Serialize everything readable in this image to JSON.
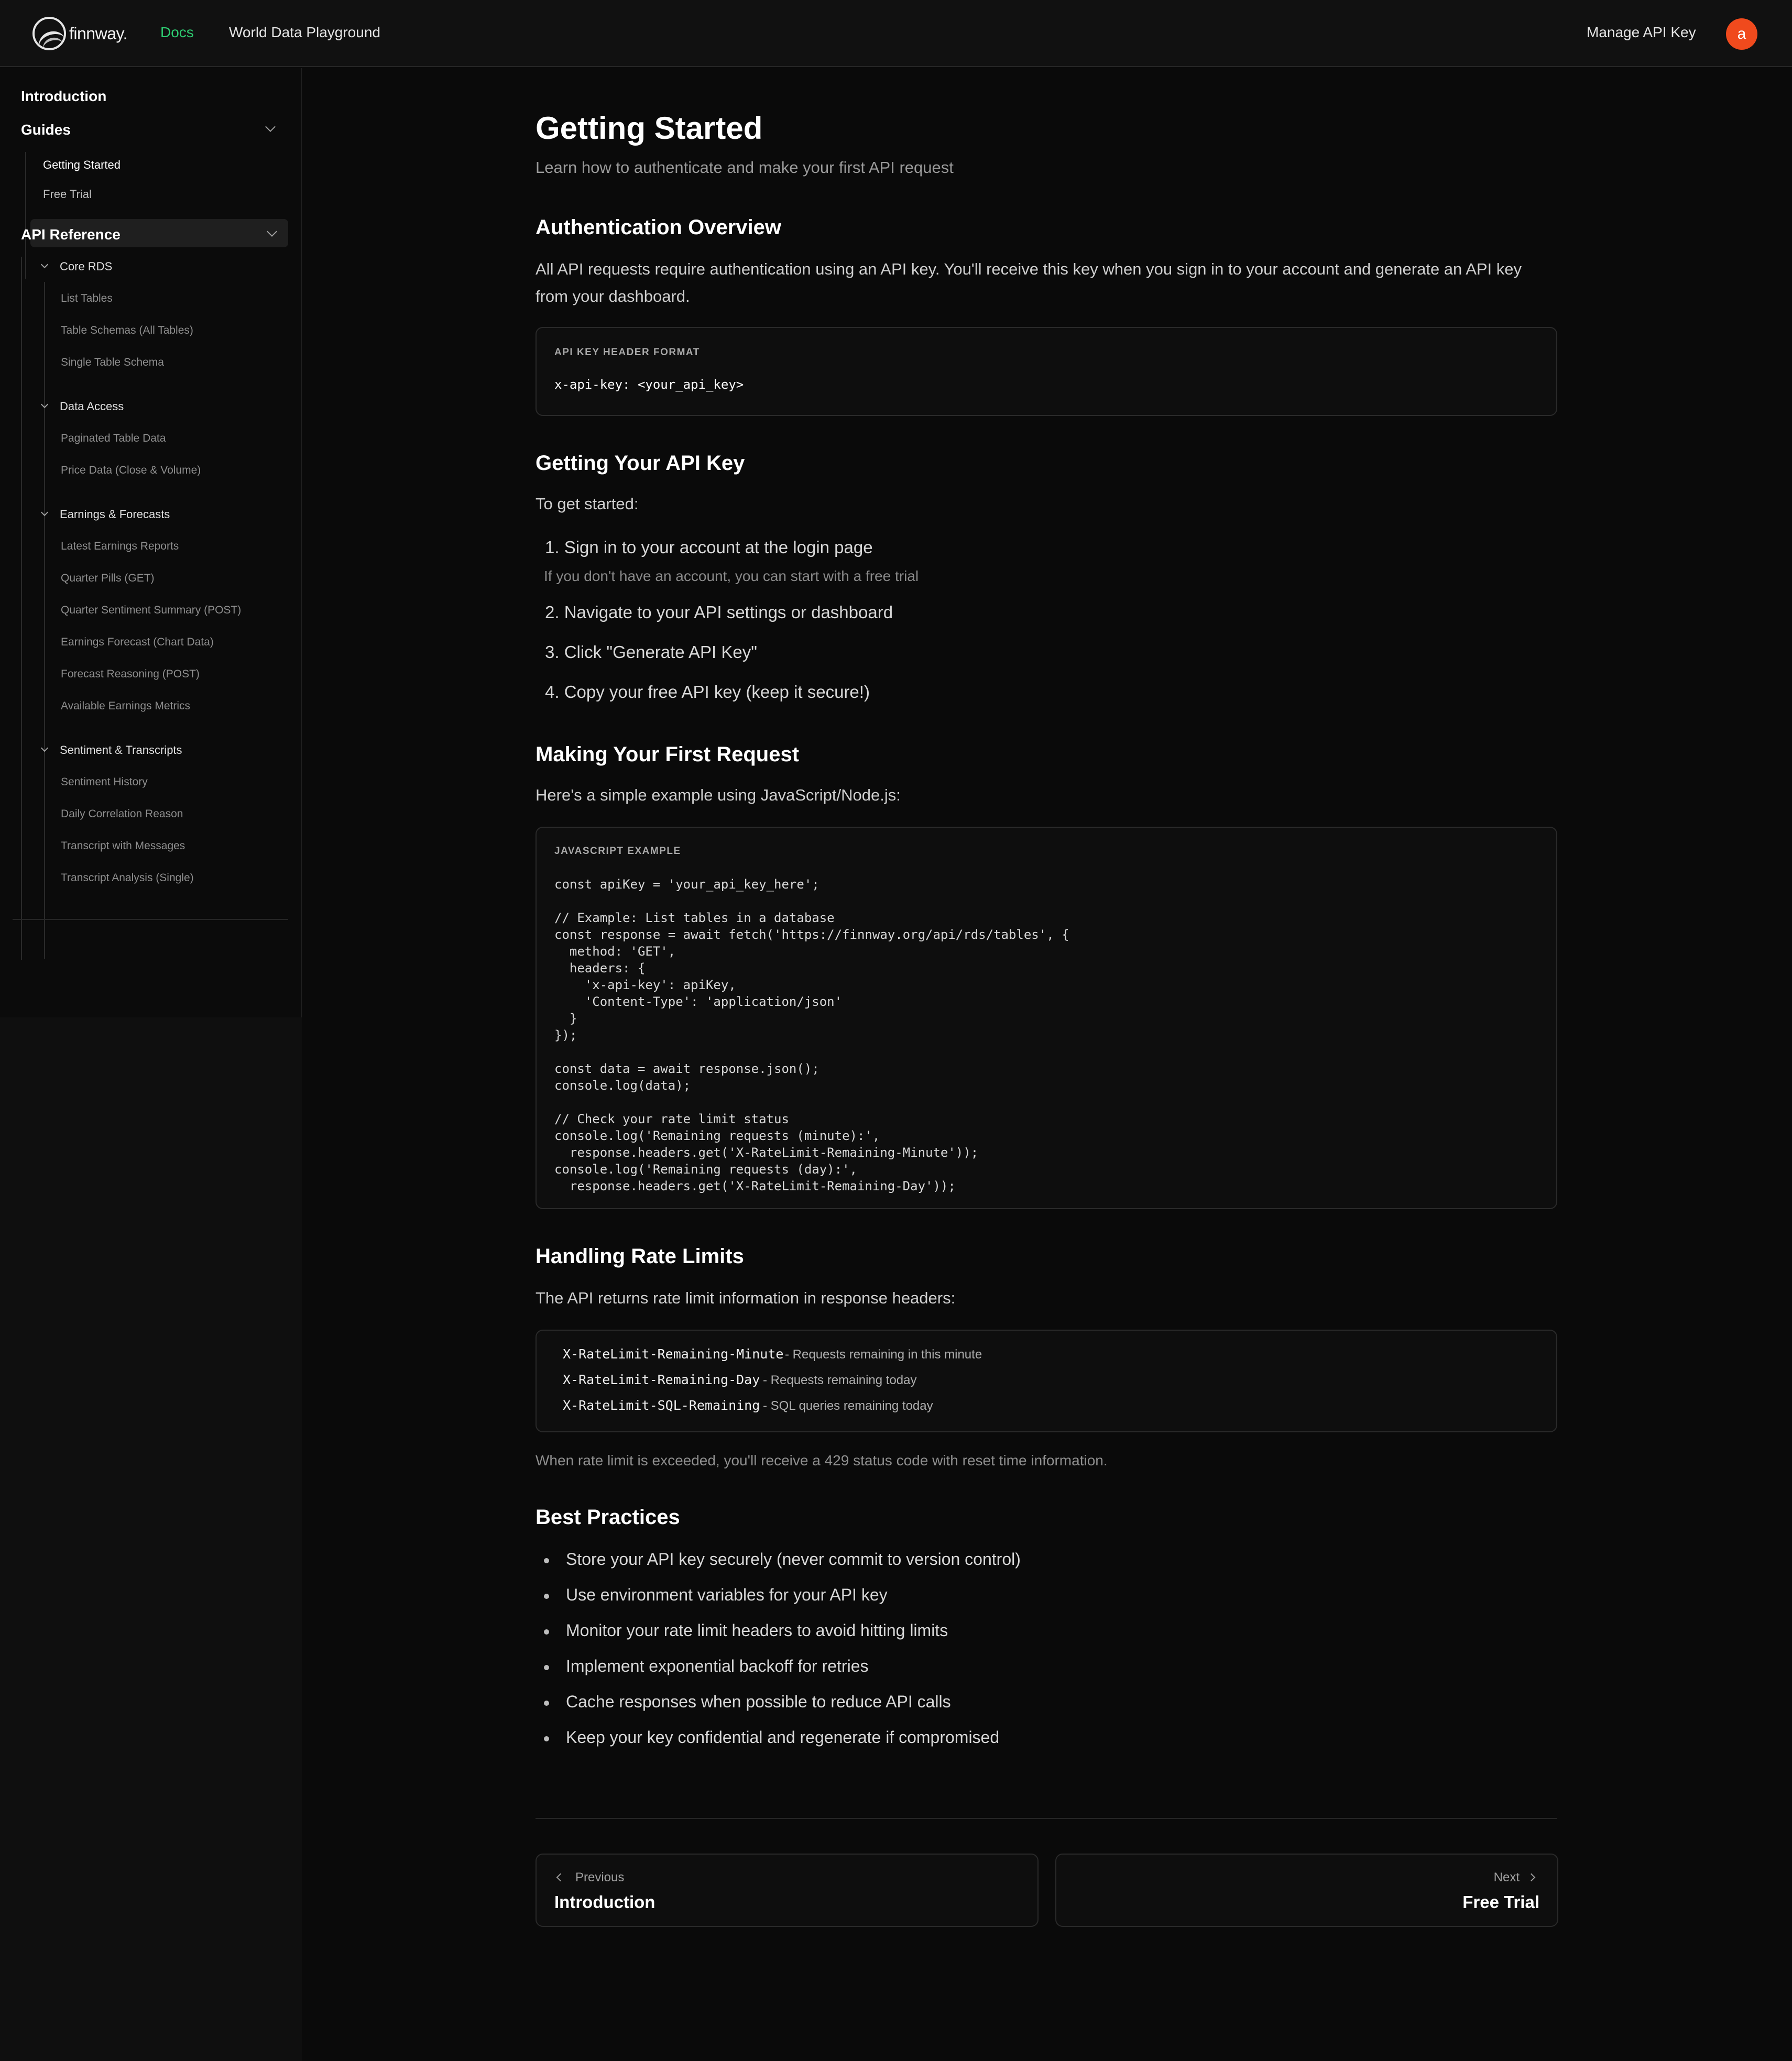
{
  "header": {
    "logo_text": "finnway.",
    "nav": {
      "docs": "Docs",
      "playground": "World Data Playground"
    },
    "manage_api_key": "Manage API Key",
    "avatar_initial": "a",
    "colors": {
      "docs_active": "#2ecc71",
      "avatar_bg": "#f04a1d"
    }
  },
  "sidebar": {
    "introduction": "Introduction",
    "guides": {
      "label": "Guides",
      "items": [
        "Getting Started",
        "Free Trial"
      ],
      "active": "Getting Started"
    },
    "api_reference": {
      "label": "API Reference",
      "groups": [
        {
          "label": "Core RDS",
          "items": [
            "List Tables",
            "Table Schemas (All Tables)",
            "Single Table Schema"
          ]
        },
        {
          "label": "Data Access",
          "items": [
            "Paginated Table Data",
            "Price Data (Close & Volume)"
          ]
        },
        {
          "label": "Earnings & Forecasts",
          "items": [
            "Latest Earnings Reports",
            "Quarter Pills (GET)",
            "Quarter Sentiment Summary (POST)",
            "Earnings Forecast (Chart Data)",
            "Forecast Reasoning (POST)",
            "Available Earnings Metrics"
          ]
        },
        {
          "label": "Sentiment & Transcripts",
          "items": [
            "Sentiment History",
            "Daily Correlation Reason",
            "Transcript with Messages",
            "Transcript Analysis (Single)"
          ]
        }
      ]
    }
  },
  "main": {
    "title": "Getting Started",
    "lead": "Learn how to authenticate and make your first API request",
    "auth": {
      "heading": "Authentication Overview",
      "body": "All API requests require authentication using an API key. You'll receive this key when you sign in to your account and generate an API key from your dashboard.",
      "code_label": "API KEY HEADER FORMAT",
      "code": "x-api-key: <your_api_key>"
    },
    "get_key": {
      "heading": "Getting Your API Key",
      "intro": "To get started:",
      "steps": [
        "1. Sign in to your account at the login page",
        "2. Navigate to your API settings or dashboard",
        "3. Click \"Generate API Key\"",
        "4. Copy your free API key (keep it secure!)"
      ],
      "note": "If you don't have an account, you can start with a free trial"
    },
    "first_request": {
      "heading": "Making Your First Request",
      "intro": "Here's a simple example using JavaScript/Node.js:",
      "code_label": "JAVASCRIPT EXAMPLE",
      "code_lines": [
        "const apiKey = 'your_api_key_here';",
        "",
        "// Example: List tables in a database",
        "const response = await fetch('https://finnway.org/api/rds/tables', {",
        "  method: 'GET',",
        "  headers: {",
        "    'x-api-key': apiKey,",
        "    'Content-Type': 'application/json'",
        "  }",
        "});",
        "",
        "const data = await response.json();",
        "console.log(data);",
        "",
        "// Check your rate limit status",
        "console.log('Remaining requests (minute):',",
        "  response.headers.get('X-RateLimit-Remaining-Minute'));",
        "console.log('Remaining requests (day):',",
        "  response.headers.get('X-RateLimit-Remaining-Day'));"
      ]
    },
    "rate_limits": {
      "heading": "Handling Rate Limits",
      "intro": "The API returns rate limit information in response headers:",
      "headers": [
        {
          "key": "X-RateLimit-Remaining-Minute",
          "desc": "- Requests remaining in this minute"
        },
        {
          "key": "X-RateLimit-Remaining-Day",
          "desc": "- Requests remaining today"
        },
        {
          "key": "X-RateLimit-SQL-Remaining",
          "desc": "- SQL queries remaining today"
        }
      ],
      "note": "When rate limit is exceeded, you'll receive a 429 status code with reset time information."
    },
    "best_practices": {
      "heading": "Best Practices",
      "items": [
        "Store your API key securely (never commit to version control)",
        "Use environment variables for your API key",
        "Monitor your rate limit headers to avoid hitting limits",
        "Implement exponential backoff for retries",
        "Cache responses when possible to reduce API calls",
        "Keep your key confidential and regenerate if compromised"
      ]
    },
    "pager": {
      "prev_label": "Previous",
      "prev_title": "Introduction",
      "next_label": "Next",
      "next_title": "Free Trial"
    }
  }
}
